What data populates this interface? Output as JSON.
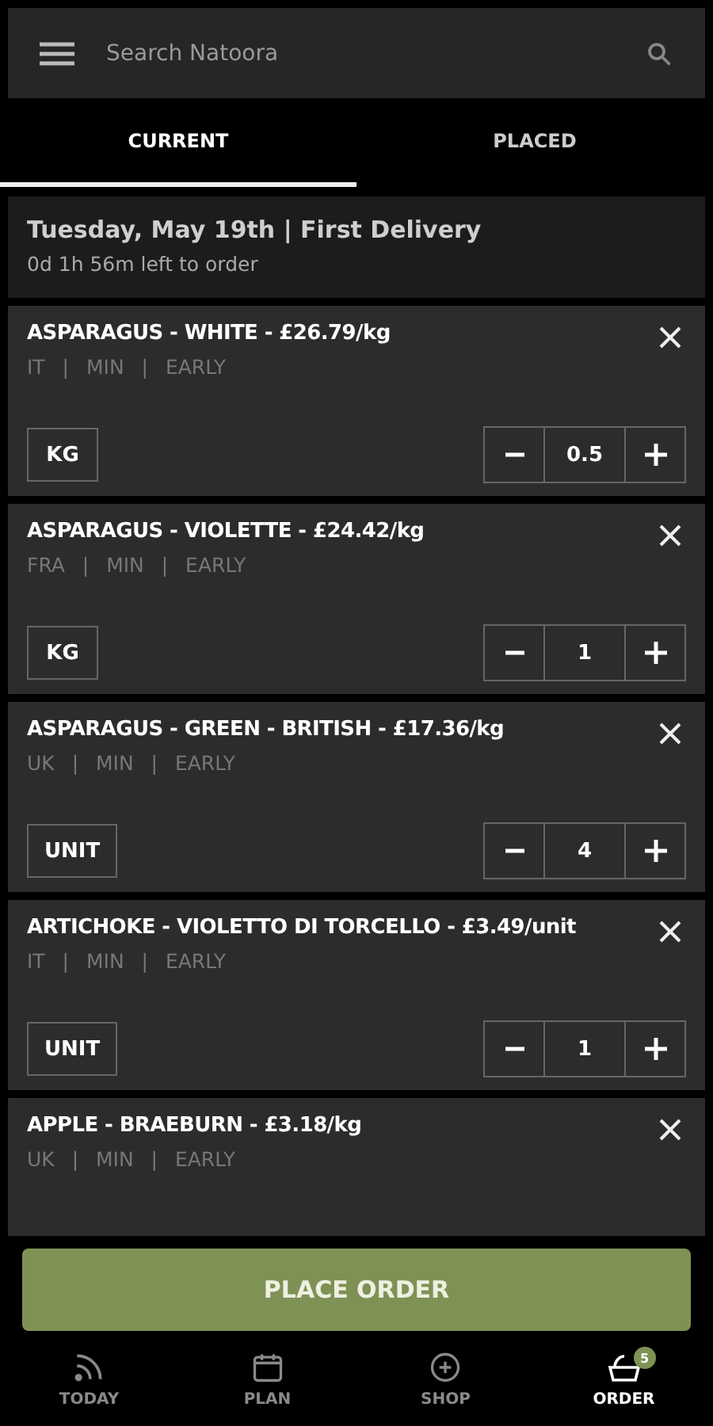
{
  "search": {
    "placeholder": "Search Natoora"
  },
  "tabs": [
    {
      "label": "CURRENT",
      "selected": true
    },
    {
      "label": "PLACED",
      "selected": false
    }
  ],
  "delivery": {
    "title": "Tuesday, May 19th | First Delivery",
    "countdown": "0d 1h 56m left to order"
  },
  "items": [
    {
      "name": "ASPARAGUS - WHITE - £26.79/kg",
      "meta": "IT | MIN | EARLY",
      "unit": "KG",
      "quantity": "0.5"
    },
    {
      "name": "ASPARAGUS - VIOLETTE - £24.42/kg",
      "meta": "FRA | MIN | EARLY",
      "unit": "KG",
      "quantity": "1"
    },
    {
      "name": "ASPARAGUS - GREEN - BRITISH - £17.36/kg",
      "meta": "UK | MIN | EARLY",
      "unit": "UNIT",
      "quantity": "4"
    },
    {
      "name": "ARTICHOKE - VIOLETTO DI TORCELLO - £3.49/unit",
      "meta": "IT | MIN | EARLY",
      "unit": "UNIT",
      "quantity": "1"
    },
    {
      "name": "APPLE - BRAEBURN - £3.18/kg",
      "meta": "UK | MIN | EARLY"
    }
  ],
  "place_order": "PLACE ORDER",
  "nav": [
    {
      "label": "TODAY",
      "selected": false
    },
    {
      "label": "PLAN",
      "selected": false
    },
    {
      "label": "SHOP",
      "selected": false
    },
    {
      "label": "ORDER",
      "selected": true,
      "badge": "5"
    }
  ]
}
